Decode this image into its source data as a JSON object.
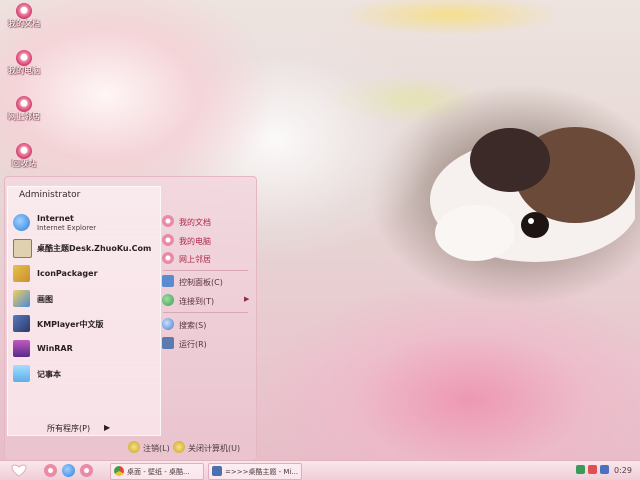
{
  "desktop_icons": [
    {
      "label": "我的文档",
      "icon": "flower-icon"
    },
    {
      "label": "我的电脑",
      "icon": "flower-icon"
    },
    {
      "label": "网上邻居",
      "icon": "flower-icon"
    },
    {
      "label": "回收站",
      "icon": "flower-icon"
    }
  ],
  "start_menu": {
    "user_name": "Administrator",
    "pinned": [
      {
        "label": "Internet",
        "sublabel": "Internet Explorer",
        "icon": "internet-explorer-icon",
        "color": "#2f7fd8"
      },
      {
        "label": "桌酷主题Desk.ZhuoKu.Com",
        "icon": "zhuoku-theme-icon",
        "color": "#e0d2b0"
      }
    ],
    "programs": [
      {
        "label": "IconPackager",
        "icon": "iconpackager-icon",
        "color": "#c9902a"
      },
      {
        "label": "画图",
        "icon": "paint-icon",
        "color": "#4a8ad8"
      },
      {
        "label": "KMPlayer中文版",
        "icon": "kmplayer-icon",
        "color": "#2a3a6a"
      },
      {
        "label": "WinRAR",
        "icon": "winrar-icon",
        "color": "#8a3a9a"
      },
      {
        "label": "记事本",
        "icon": "notepad-icon",
        "color": "#5ab0e8"
      }
    ],
    "all_programs": "所有程序(P)",
    "all_programs_arrow": "▶",
    "right_places": [
      {
        "label": "我的文档",
        "icon": "my-documents-icon",
        "color": "#e98aa6"
      },
      {
        "label": "我的电脑",
        "icon": "my-computer-icon",
        "color": "#e98aa6"
      },
      {
        "label": "网上邻居",
        "icon": "network-places-icon",
        "color": "#e98aa6"
      }
    ],
    "right_system": [
      {
        "label": "控制面板(C)",
        "icon": "control-panel-icon",
        "color": "#5a8ad0"
      },
      {
        "label": "连接到(T)",
        "icon": "connect-to-icon",
        "color": "#3a9a5a",
        "arrow": "▶"
      }
    ],
    "right_tools": [
      {
        "label": "搜索(S)",
        "icon": "search-icon",
        "color": "#4a7ac8"
      },
      {
        "label": "运行(R)",
        "icon": "run-icon",
        "color": "#5a7ab0"
      }
    ],
    "log_off": "注销(L)",
    "shut_down": "关闭计算机(U)"
  },
  "taskbar": {
    "tasks": [
      {
        "label": "桌面 - 壁纸 - 桌酷...",
        "icon": "chrome-icon",
        "color": "#e0b040"
      },
      {
        "label": "=>>>桌酷主题 - Mi...",
        "icon": "window-icon",
        "color": "#4a70b0"
      }
    ],
    "clock": "0:29"
  },
  "colors": {
    "accent": "#e98aa6",
    "menu_text": "#b0284a",
    "taskbar": "#f3d6de"
  }
}
